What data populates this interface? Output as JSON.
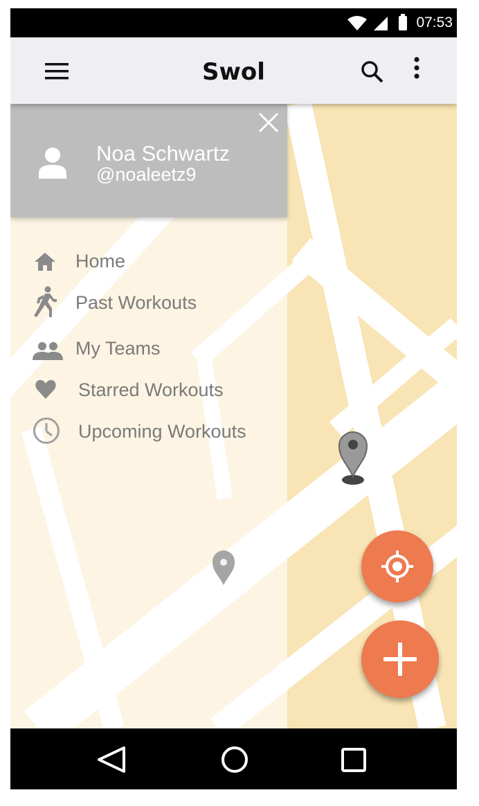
{
  "status_bar": {
    "time": "07:53"
  },
  "app_bar": {
    "title": "Swol"
  },
  "drawer": {
    "profile": {
      "name": "Noa Schwartz",
      "handle": "@noaleetz9"
    },
    "items": [
      {
        "label": "Home",
        "icon": "home-icon"
      },
      {
        "label": "Past Workouts",
        "icon": "run-icon"
      },
      {
        "label": "My Teams",
        "icon": "group-icon"
      },
      {
        "label": "Starred Workouts",
        "icon": "heart-icon"
      },
      {
        "label": "Upcoming Workouts",
        "icon": "clock-icon"
      }
    ]
  },
  "colors": {
    "accent": "#ee7a50",
    "drawer_header": "#bdbdbd",
    "map_base": "#fdf4e3",
    "map_block": "#f8e4b4"
  }
}
